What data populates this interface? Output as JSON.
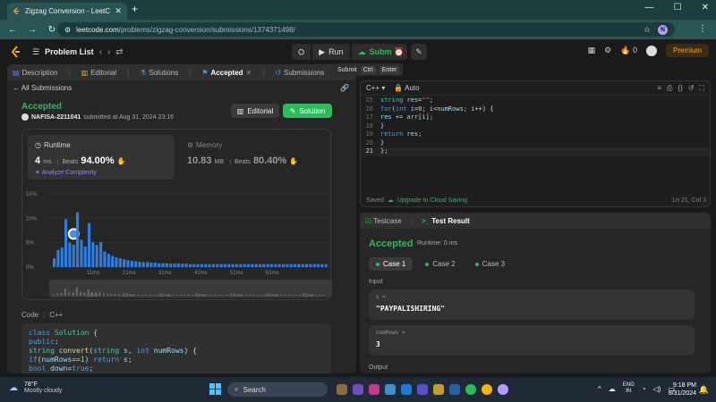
{
  "browser": {
    "tab_title": "Zigzag Conversion - LeetCode",
    "url_host": "leetcode.com",
    "url_path": "/problems/zigzag-conversion/submissions/1374371498/",
    "profile_initial": "N"
  },
  "nav": {
    "problem_list": "Problem List",
    "run": "Run",
    "submit": "Submit",
    "points": "0",
    "premium": "Premium"
  },
  "tooltip": {
    "label": "Submit",
    "key1": "Ctrl",
    "key2": "Enter"
  },
  "left_tabs": [
    {
      "label": "Description"
    },
    {
      "label": "Editorial"
    },
    {
      "label": "Solutions"
    },
    {
      "label": "Accepted"
    },
    {
      "label": "Submissions"
    }
  ],
  "submission": {
    "back_label": "All Submissions",
    "status": "Accepted",
    "user": "NAFISA-2211041",
    "submitted_text": "submitted at Aug 31, 2024 23:16",
    "editorial_btn": "Editorial",
    "solution_btn": "Solution"
  },
  "runtime": {
    "title": "Runtime",
    "value": "4",
    "unit": "ms",
    "beats_label": "Beats",
    "beats": "94.00%",
    "analyze": "Analyze Complexity"
  },
  "memory": {
    "title": "Memory",
    "value": "10.83",
    "unit": "MB",
    "beats_label": "Beats",
    "beats": "80.40%"
  },
  "chart_data": {
    "type": "bar",
    "y_ticks": [
      "15%",
      "10%",
      "5%",
      "0%"
    ],
    "ylim": [
      0,
      15
    ],
    "x_ticks": [
      "11ms",
      "21ms",
      "31ms",
      "41ms",
      "51ms",
      "61ms"
    ],
    "mini_x_ticks": [
      "11ms",
      "21ms",
      "31ms",
      "41ms",
      "51ms",
      "61ms",
      "71ms"
    ],
    "values": [
      1.8,
      3.5,
      4.0,
      9.8,
      5.0,
      4.6,
      11.2,
      5.6,
      4.2,
      9.0,
      5.1,
      4.5,
      5.1,
      3.2,
      2.7,
      2.3,
      2.0,
      1.8,
      1.6,
      1.4,
      1.3,
      1.2,
      1.1,
      1.0,
      1.0,
      0.9,
      0.9,
      0.8,
      0.8,
      0.8,
      0.7,
      0.7,
      0.7,
      0.7,
      0.7,
      0.6,
      0.6,
      0.6,
      0.6,
      0.6,
      0.6,
      0.6,
      0.6,
      0.6,
      0.6,
      0.6,
      0.6,
      0.6,
      0.6,
      0.6,
      0.6,
      0.6,
      0.6,
      0.6,
      0.6,
      0.6,
      0.6,
      0.6,
      0.6,
      0.6,
      0.6,
      0.6,
      0.6,
      0.6,
      0.6,
      0.6,
      0.6,
      0.6,
      0.6,
      0.6,
      0.6
    ],
    "highlight_index": 5,
    "grid": true
  },
  "code_section": {
    "label": "Code",
    "lang": "C++",
    "lines": [
      "class Solution {",
      "public:",
      "    string convert(string s, int numRows) {",
      "        if(numRows==1) return s;",
      "        bool down=true;"
    ]
  },
  "editor": {
    "lang": "C++",
    "mode": "Auto",
    "lines": [
      {
        "n": "15",
        "code": "        string res=\"\";"
      },
      {
        "n": "16",
        "code": "        for(int i=0; i<numRows; i++) {"
      },
      {
        "n": "17",
        "code": "            res += arr[i];"
      },
      {
        "n": "18",
        "code": "        }"
      },
      {
        "n": "19",
        "code": "        return res;"
      },
      {
        "n": "20",
        "code": "    }"
      },
      {
        "n": "21",
        "code": "};"
      }
    ],
    "saved": "Saved",
    "upgrade": "Upgrade to Cloud Saving",
    "position": "Ln 21, Col 3"
  },
  "result": {
    "tab_testcase": "Testcase",
    "tab_result": "Test Result",
    "status": "Accepted",
    "runtime": "Runtime: 0 ms",
    "cases": [
      "Case 1",
      "Case 2",
      "Case 3"
    ],
    "input_label": "Input",
    "var1_name": "s =",
    "var1_value": "\"PAYPALISHIRING\"",
    "var2_name": "numRows =",
    "var2_value": "3",
    "output_label": "Output"
  },
  "taskbar": {
    "temp": "78°F",
    "condition": "Mostly cloudy",
    "search": "Search",
    "lang1": "ENG",
    "lang2": "IN",
    "time": "9:18 PM",
    "date": "8/31/2024"
  }
}
